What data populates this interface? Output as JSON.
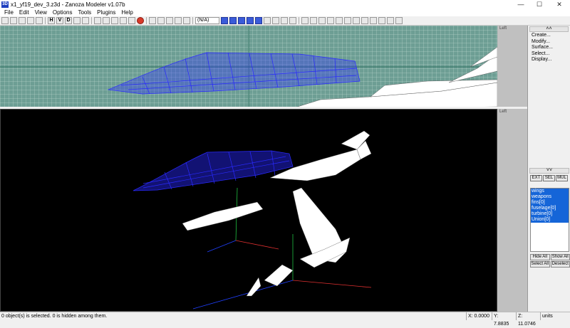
{
  "window": {
    "title": "x1_yf19_dev_3.z3d - Zanoza Modeler v1.07b",
    "app_icon": "3D",
    "minimize": "—",
    "maximize": "☐",
    "close": "✕"
  },
  "menu": [
    "File",
    "Edit",
    "View",
    "Options",
    "Tools",
    "Plugins",
    "Help"
  ],
  "toolbar": {
    "combo_value": "(N/A)",
    "buttons": [
      "H",
      "V",
      "D"
    ]
  },
  "viewports": {
    "top_side_label": "Left",
    "bottom_side_label": "Left",
    "top_label": "Left"
  },
  "panel": {
    "header_chevron": "˄˄",
    "menu": [
      "Create...",
      "Modify...",
      "Surface...",
      "Select...",
      "Display..."
    ],
    "mid_chevron": "˅˅",
    "modes": [
      "EXT",
      "SEL",
      "MUL"
    ],
    "objects": [
      "wings",
      "weapons",
      "fins[0]",
      "fuselage[0]",
      "turbine[0]",
      "Union[0]"
    ],
    "list_buttons": [
      "Hide All",
      "Show All",
      "Select All",
      "Deselect"
    ]
  },
  "status": {
    "message": "0 object(s) is selected. 0 is hidden among them.",
    "x": "X: 0.0000",
    "y": "Y: 7.8835",
    "z": "Z: 11.0746",
    "units": "units"
  },
  "colors": {
    "top_viewport_bg": "#6d9e94",
    "persp_bg": "#000000",
    "mesh_selected": "#2a2aff",
    "mesh_white": "#ffffff",
    "selection_blue": "#1565d8"
  }
}
